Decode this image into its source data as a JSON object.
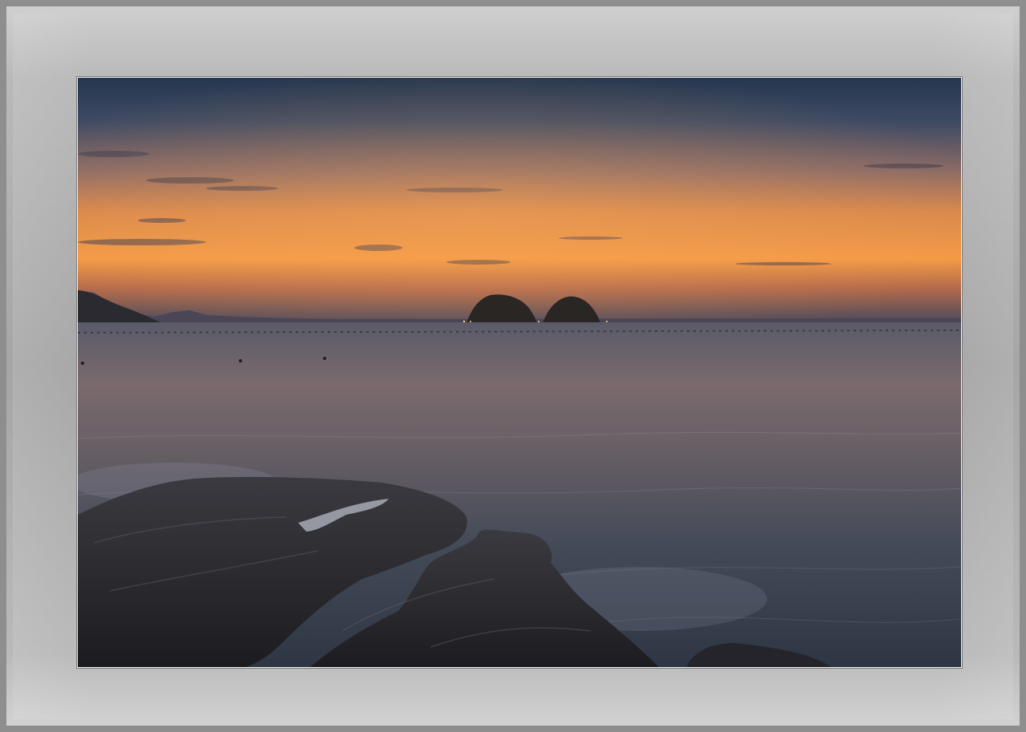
{
  "scene": {
    "colors": {
      "mat_light": "#cfcfcf",
      "mat_dark": "#8e8e8e",
      "sky_top": "#2a3a54",
      "sky_mid": "#d98a4a",
      "horizon_glow": "#f2a050",
      "sea": "#3a4250",
      "rocks": "#26262a"
    }
  }
}
